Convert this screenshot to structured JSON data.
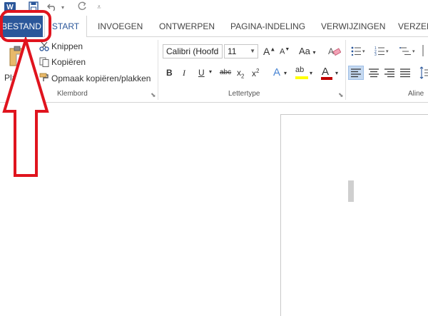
{
  "app": {
    "logo_letter": "W"
  },
  "tabs": {
    "file": "BESTAND",
    "items": [
      "START",
      "INVOEGEN",
      "ONTWERPEN",
      "PAGINA-INDELING",
      "VERWIJZINGEN",
      "VERZEN"
    ]
  },
  "clipboard": {
    "paste_label": "Plakken",
    "cut": "Knippen",
    "copy": "Kopiëren",
    "format_painter": "Opmaak kopiëren/plakken",
    "group_label": "Klembord"
  },
  "font": {
    "font_name": "Calibri (Hoofd",
    "font_size": "11",
    "grow": "A",
    "shrink": "A",
    "change_case": "Aa",
    "bold": "B",
    "italic": "I",
    "underline": "U",
    "strike": "abc",
    "subscript": "x",
    "subscript_mark": "2",
    "superscript": "x",
    "superscript_mark": "2",
    "text_effects": "A",
    "highlight": "ab",
    "font_color": "A",
    "group_label": "Lettertype"
  },
  "paragraph": {
    "group_label": "Aline"
  },
  "colors": {
    "accent": "#2b579a",
    "annotation": "#e0141e",
    "highlight_yellow": "#ffff00",
    "font_red": "#c00000"
  }
}
